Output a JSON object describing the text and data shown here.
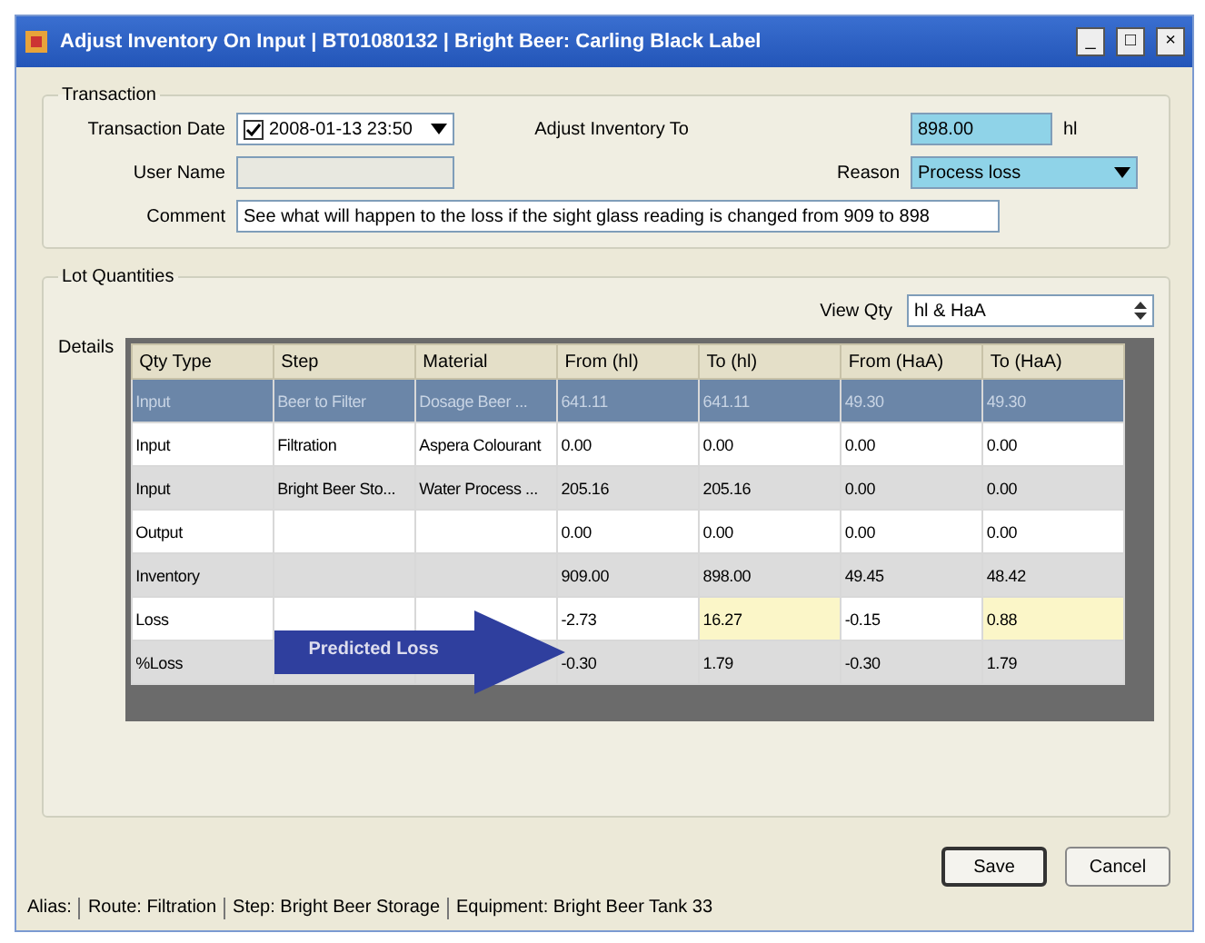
{
  "window": {
    "title": "Adjust Inventory On Input | BT01080132 | Bright Beer: Carling Black Label",
    "controls": [
      "_",
      "□",
      "×"
    ]
  },
  "transaction": {
    "legend": "Transaction",
    "date_label": "Transaction Date",
    "date_checked": true,
    "date_value": "2008-01-13 23:50",
    "user_label": "User Name",
    "user_disabled": true,
    "comment_label": "Comment",
    "comment_value": "See what will happen to the loss if the sight glass reading is changed from 909 to 898",
    "adjust_label": "Adjust Inventory To",
    "adjust_value": "898.00",
    "adjust_unit": "hl",
    "reason_label": "Reason",
    "reason_value": "Process loss"
  },
  "lot_quantities": {
    "legend": "Lot Quantities",
    "view_label": "View Qty",
    "view_value": "hl & HaA",
    "details_label": "Details",
    "table": {
      "columns": [
        "Qty Type",
        "Step",
        "Material",
        "From (hl)",
        "To (hl)",
        "From (HaA)",
        "To (HaA)"
      ],
      "rows": [
        {
          "selected": true,
          "highlight": false,
          "cells": [
            "Input",
            "Beer to Filter",
            "Dosage Beer ...",
            "641.11",
            "641.11",
            "49.30",
            "49.30"
          ]
        },
        {
          "selected": false,
          "highlight": false,
          "cells": [
            "Input",
            "Filtration",
            "Aspera Colourant",
            "0.00",
            "0.00",
            "0.00",
            "0.00"
          ]
        },
        {
          "selected": false,
          "highlight": false,
          "cells": [
            "Input",
            "Bright Beer Sto...",
            "Water Process ...",
            "205.16",
            "205.16",
            "0.00",
            "0.00"
          ]
        },
        {
          "selected": false,
          "highlight": false,
          "cells": [
            "Output",
            "",
            "",
            "0.00",
            "0.00",
            "0.00",
            "0.00"
          ]
        },
        {
          "selected": false,
          "highlight": false,
          "cells": [
            "Inventory",
            "",
            "",
            "909.00",
            "898.00",
            "49.45",
            "48.42"
          ]
        },
        {
          "selected": false,
          "highlight": true,
          "cells": [
            "Loss",
            "",
            "",
            "-2.73",
            "16.27",
            "-0.15",
            "0.88"
          ]
        },
        {
          "selected": false,
          "highlight": false,
          "cells": [
            "%Loss",
            "",
            "",
            "-0.30",
            "1.79",
            "-0.30",
            "1.79"
          ]
        }
      ]
    },
    "callout": "Predicted Loss"
  },
  "buttons": [
    {
      "label": "Save",
      "default": true
    },
    {
      "label": "Cancel",
      "default": false
    }
  ],
  "status_bar": [
    "Alias:",
    "Route: Filtration",
    "Step: Bright Beer Storage",
    "Equipment: Bright Beer Tank 33"
  ]
}
